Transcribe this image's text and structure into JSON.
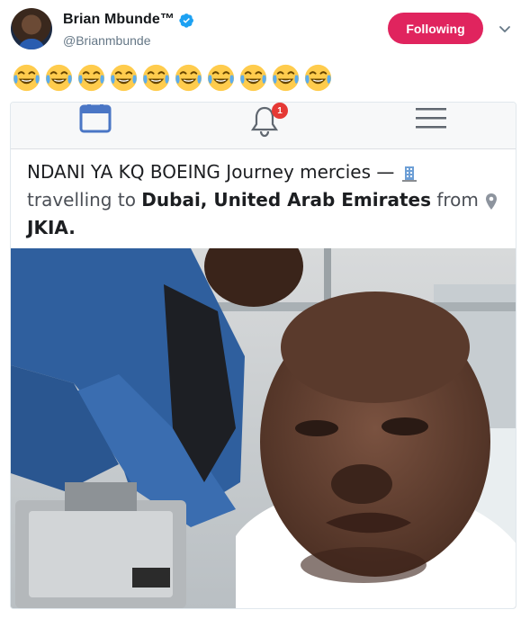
{
  "tweet": {
    "display_name": "Brian Mbunde™",
    "handle": "@Brianmbunde",
    "follow_label": "Following",
    "emoji_count": 10,
    "emoji_name": "face-with-tears-of-joy-icon"
  },
  "colors": {
    "follow_button": "#e0245e",
    "verified_badge": "#1da1f2",
    "handle_text": "#657786"
  },
  "embedded_post": {
    "line1": "NDANI YA KQ BOEING Journey mercies —",
    "line2_prefix": "travelling to",
    "destination": "Dubai, United Arab Emirates",
    "from_word": "from",
    "origin": "JKIA.",
    "notification_count": "1"
  }
}
